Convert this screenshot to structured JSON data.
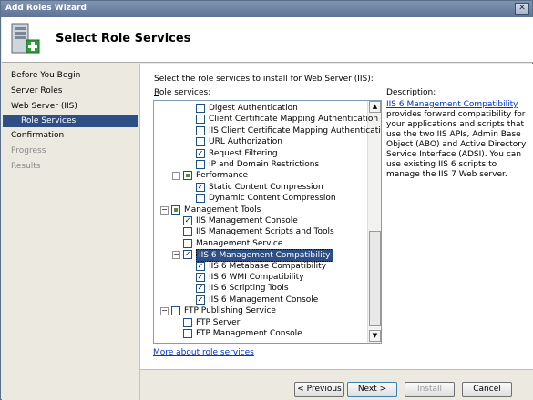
{
  "window": {
    "title": "Add Roles Wizard"
  },
  "header": {
    "title": "Select Role Services"
  },
  "nav": {
    "items": [
      {
        "label": "Before You Begin",
        "state": "normal"
      },
      {
        "label": "Server Roles",
        "state": "normal"
      },
      {
        "label": "Web Server (IIS)",
        "state": "normal"
      },
      {
        "label": "Role Services",
        "state": "selected"
      },
      {
        "label": "Confirmation",
        "state": "normal"
      },
      {
        "label": "Progress",
        "state": "dim"
      },
      {
        "label": "Results",
        "state": "dim"
      }
    ]
  },
  "main": {
    "instruction": "Select the role services to install for Web Server (IIS):",
    "role_services_label_prefix": "R",
    "role_services_label_rest": "ole services:",
    "description_label": "Description:",
    "description_link": "IIS 6 Management Compatibility",
    "description_text": "provides forward compatibility for your applications and scripts that use the two IIS APIs, Admin Base Object (ABO) and Active Directory Service Interface (ADSI). You can use existing IIS 6 scripts to manage the IIS 7 Web server.",
    "more_link": "More about role services"
  },
  "tree": {
    "rows": [
      {
        "label": "Digest Authentication",
        "checked": false,
        "level": 3
      },
      {
        "label": "Client Certificate Mapping Authentication",
        "checked": false,
        "level": 3
      },
      {
        "label": "IIS Client Certificate Mapping Authentication",
        "checked": false,
        "level": 3
      },
      {
        "label": "URL Authorization",
        "checked": false,
        "level": 3
      },
      {
        "label": "Request Filtering",
        "checked": true,
        "level": 3
      },
      {
        "label": "IP and Domain Restrictions",
        "checked": false,
        "level": 3
      },
      {
        "label": "Performance",
        "checked": "partial",
        "level": 2,
        "expander": "−"
      },
      {
        "label": "Static Content Compression",
        "checked": true,
        "level": 3
      },
      {
        "label": "Dynamic Content Compression",
        "checked": false,
        "level": 3
      },
      {
        "label": "Management Tools",
        "checked": "partial",
        "level": 1,
        "expander": "−"
      },
      {
        "label": "IIS Management Console",
        "checked": true,
        "level": 2
      },
      {
        "label": "IIS Management Scripts and Tools",
        "checked": false,
        "level": 2
      },
      {
        "label": "Management Service",
        "checked": false,
        "level": 2
      },
      {
        "label": "IIS 6 Management Compatibility",
        "checked": true,
        "level": 2,
        "expander": "−",
        "selected": true
      },
      {
        "label": "IIS 6 Metabase Compatibility",
        "checked": true,
        "level": 3
      },
      {
        "label": "IIS 6 WMI Compatibility",
        "checked": true,
        "level": 3
      },
      {
        "label": "IIS 6 Scripting Tools",
        "checked": true,
        "level": 3
      },
      {
        "label": "IIS 6 Management Console",
        "checked": true,
        "level": 3
      },
      {
        "label": "FTP Publishing Service",
        "checked": false,
        "level": 1,
        "expander": "−"
      },
      {
        "label": "FTP Server",
        "checked": false,
        "level": 2
      },
      {
        "label": "FTP Management Console",
        "checked": false,
        "level": 2
      }
    ]
  },
  "buttons": {
    "previous": "< Previous",
    "next": "Next >",
    "install": "Install",
    "cancel": "Cancel"
  },
  "icons": {
    "close": "close-icon",
    "wizard": "server-add-icon",
    "check": "✓",
    "scroll_up": "▲",
    "scroll_down": "▼"
  }
}
